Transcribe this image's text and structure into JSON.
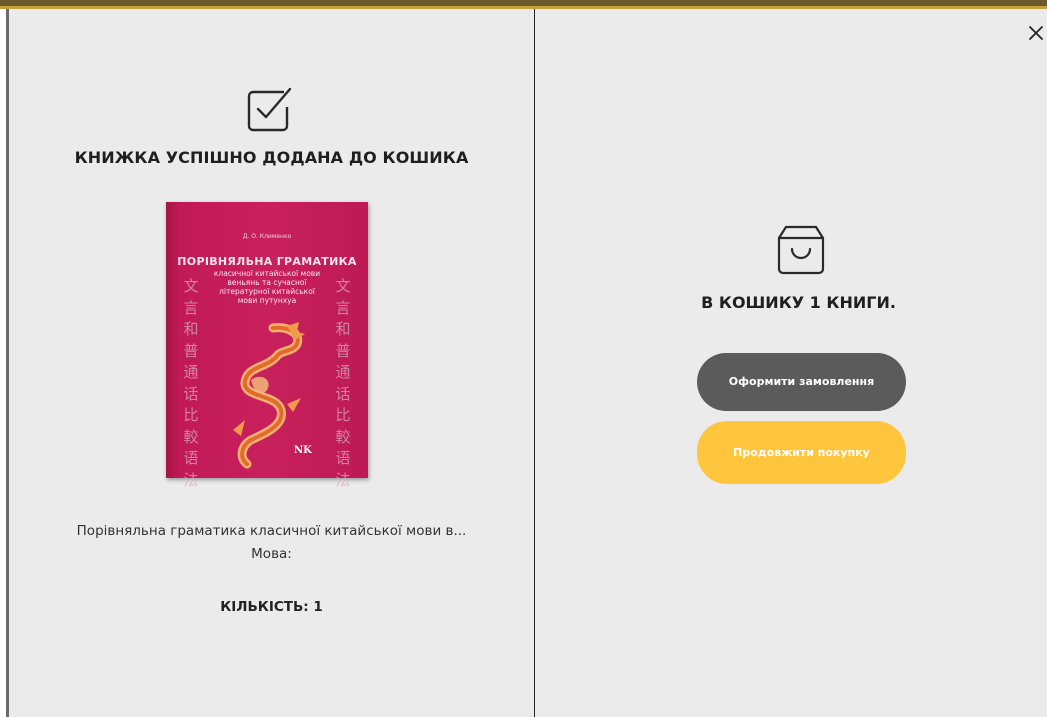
{
  "colors": {
    "panel_bg": "#ebebeb",
    "checkout_button": "#5b5b5b",
    "continue_button": "#ffc53d",
    "book_cover": "#c8205c"
  },
  "icons": {
    "close": "close-icon",
    "added": "checkbox-check-icon",
    "cart": "shopping-bag-icon"
  },
  "left": {
    "title": "КНИЖКА УСПІШНО ДОДАНА ДО КОШИКА",
    "cover": {
      "author": "Д. О. Клименко",
      "title": "ПОРІВНЯЛЬНА ГРАМАТИКА",
      "subtitle_lines": [
        "класичної китайської мови",
        "веньянь та сучасної",
        "літературної китайської",
        "мови путунхуа"
      ],
      "hanzi": [
        "文",
        "言",
        "和",
        "普",
        "通",
        "话",
        "比",
        "較",
        "语",
        "法"
      ],
      "publisher": "NK"
    },
    "book_name": "Порівняльна граматика класичної китайської мови в...",
    "language_label": "Мова:",
    "quantity_label": "КІЛЬКІСТЬ: 1"
  },
  "right": {
    "cart_count_text": "В КОШИКУ 1 КНИГИ.",
    "checkout_label": "Оформити замовлення",
    "continue_label": "Продовжити покупку"
  }
}
